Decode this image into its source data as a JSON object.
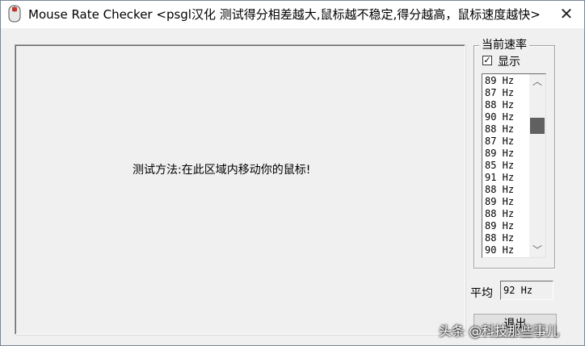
{
  "window": {
    "title": "Mouse Rate Checker <psgl汉化  测试得分相差越大,鼠标越不稳定,得分越高，鼠标速度越快>",
    "close_icon": "close-icon",
    "app_icon": "mouse-app-icon"
  },
  "canvas": {
    "instruction": "测试方法:在此区域内移动你的鼠标!"
  },
  "rate_panel": {
    "title": "当前速率",
    "show_label": "显示",
    "show_checked": true,
    "checkbox_mark": "✓",
    "rates": [
      "89 Hz",
      "87 Hz",
      "88 Hz",
      "90 Hz",
      "88 Hz",
      "87 Hz",
      "89 Hz",
      "85 Hz",
      "91 Hz",
      "88 Hz",
      "89 Hz",
      "88 Hz",
      "89 Hz",
      "88 Hz",
      "90 Hz"
    ],
    "scroll_up": "︿",
    "scroll_down": "﹀"
  },
  "average": {
    "label": "平均",
    "value": "92 Hz"
  },
  "exit_button": {
    "label": "退出"
  },
  "watermark": {
    "text": "头条 @科技那些事儿"
  }
}
